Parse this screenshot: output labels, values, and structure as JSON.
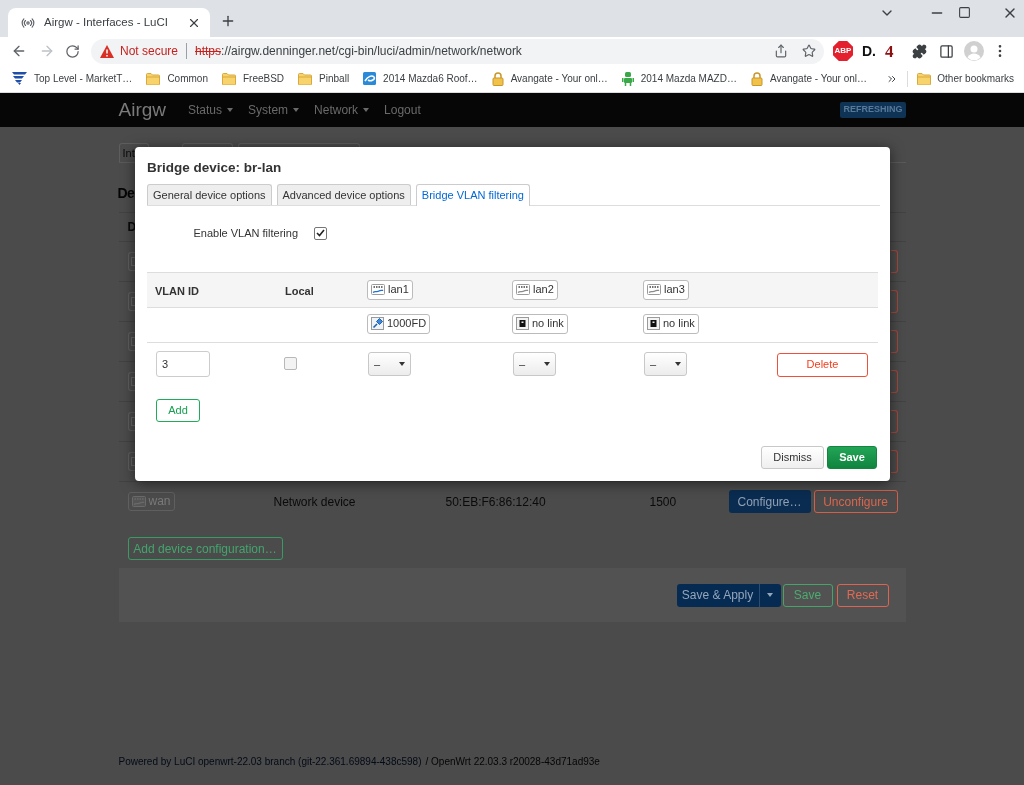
{
  "browser": {
    "tab_title": "Airgw - Interfaces - LuCI",
    "security_label": "Not secure",
    "url_scheme": "https",
    "url_rest": "://airgw.denninger.net/cgi-bin/luci/admin/network/network",
    "extensions": [
      {
        "kind": "octagon",
        "label": "ABP"
      },
      {
        "kind": "plain",
        "label": "D."
      },
      {
        "kind": "numeral",
        "label": "4"
      }
    ],
    "bookmarks": [
      {
        "kind": "stripes",
        "label": "Top Level - MarketT…"
      },
      {
        "kind": "folder",
        "label": "Common"
      },
      {
        "kind": "folder",
        "label": "FreeBSD"
      },
      {
        "kind": "folder",
        "label": "Pinball"
      },
      {
        "kind": "swirl",
        "label": "2014 Mazda6 Roof…"
      },
      {
        "kind": "lock",
        "label": "Avangate - Your onl…"
      },
      {
        "kind": "figure",
        "label": "2014 Mazda MAZD…"
      },
      {
        "kind": "lock",
        "label": "Avangate - Your onl…"
      }
    ],
    "other_bookmarks": "Other bookmarks"
  },
  "page": {
    "brand": "Airgw",
    "menu": [
      {
        "label": "Status",
        "dropdown": true
      },
      {
        "label": "System",
        "dropdown": true
      },
      {
        "label": "Network",
        "dropdown": true
      },
      {
        "label": "Logout",
        "dropdown": false
      }
    ],
    "indicator": "REFRESHING",
    "tabs": [
      {
        "kind": "text",
        "label": "Int"
      },
      {
        "kind": "edge"
      },
      {
        "kind": "edge"
      }
    ],
    "heading": "De",
    "table_header": "D",
    "devices": [
      {
        "kind": "covered"
      },
      {
        "kind": "covered"
      },
      {
        "kind": "covered"
      },
      {
        "kind": "covered"
      },
      {
        "kind": "covered"
      },
      {
        "kind": "covered"
      },
      {
        "kind": "full",
        "name": "wan",
        "type": "Network device",
        "mac": "50:EB:F6:86:12:40",
        "mtu": "1500",
        "configure": "Configure…",
        "unconfigure": "Unconfigure"
      }
    ],
    "add_device": "Add device configuration…",
    "actions": {
      "save_apply": "Save & Apply",
      "save": "Save",
      "reset": "Reset"
    },
    "footer": {
      "link": "Powered by LuCI openwrt-22.03 branch (git-22.361.69894-438c598)",
      "version": "/ OpenWrt 22.03.3 r20028-43d71ad93e"
    }
  },
  "dialog": {
    "title": "Bridge device: br-lan",
    "tabs": [
      {
        "label": "General device options",
        "selected": false
      },
      {
        "label": "Advanced device options",
        "selected": false
      },
      {
        "label": "Bridge VLAN filtering",
        "selected": true
      }
    ],
    "vlan_filtering": {
      "label": "Enable VLAN filtering",
      "checked": true
    },
    "columns": [
      "VLAN ID",
      "Local"
    ],
    "ports": [
      {
        "name": "lan1",
        "status": "1000FD",
        "linked": true
      },
      {
        "name": "lan2",
        "status": "no link",
        "linked": false
      },
      {
        "name": "lan3",
        "status": "no link",
        "linked": false
      }
    ],
    "rows": [
      {
        "vlan_id": "3",
        "local": false,
        "ports": [
          "–",
          "–",
          "–"
        ],
        "delete": "Delete"
      }
    ],
    "add": "Add",
    "dismiss": "Dismiss",
    "save": "Save"
  }
}
